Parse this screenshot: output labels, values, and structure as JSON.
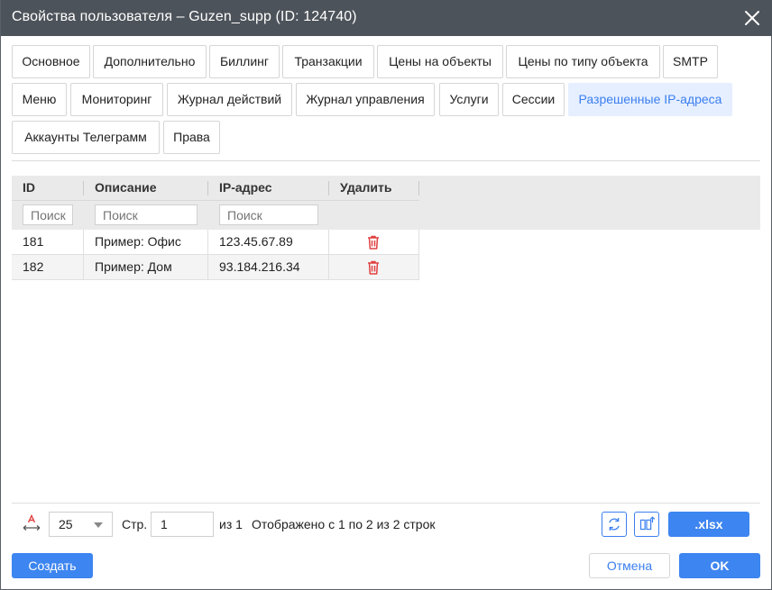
{
  "window": {
    "title": "Свойства пользователя – Guzen_supp (ID: 124740)"
  },
  "tabs": [
    {
      "label": "Основное"
    },
    {
      "label": "Дополнительно"
    },
    {
      "label": "Биллинг"
    },
    {
      "label": "Транзакции"
    },
    {
      "label": "Цены на объекты"
    },
    {
      "label": "Цены по типу объекта"
    },
    {
      "label": "SMTP"
    },
    {
      "label": "Меню"
    },
    {
      "label": "Мониторинг"
    },
    {
      "label": "Журнал действий"
    },
    {
      "label": "Журнал управления"
    },
    {
      "label": "Услуги"
    },
    {
      "label": "Сессии"
    },
    {
      "label": "Разрешенные IP-адреса"
    },
    {
      "label": "Аккаунты Телеграмм"
    },
    {
      "label": "Права"
    }
  ],
  "active_tab": "Разрешенные IP-адреса",
  "grid": {
    "columns": [
      "ID",
      "Описание",
      "IP-адрес",
      "Удалить"
    ],
    "filters": [
      "Поиск",
      "Поиск",
      "Поиск"
    ],
    "rows": [
      {
        "id": "181",
        "description": "Пример: Офис",
        "ip": "123.45.67.89"
      },
      {
        "id": "182",
        "description": "Пример: Дом",
        "ip": "93.184.216.34"
      }
    ]
  },
  "pager": {
    "page_size": "25",
    "page_label": "Стр.",
    "page_value": "1",
    "of_label": "из 1",
    "summary": "Отображено с 1 по 2 из 2 строк",
    "export_label": ".xlsx"
  },
  "footer": {
    "create_label": "Создать",
    "cancel_label": "Отмена",
    "ok_label": "OK"
  },
  "colors": {
    "titlebar": "#4d535a",
    "accent": "#3d85f0",
    "active_tab_bg": "#e6efff",
    "delete_icon": "#e04040"
  }
}
